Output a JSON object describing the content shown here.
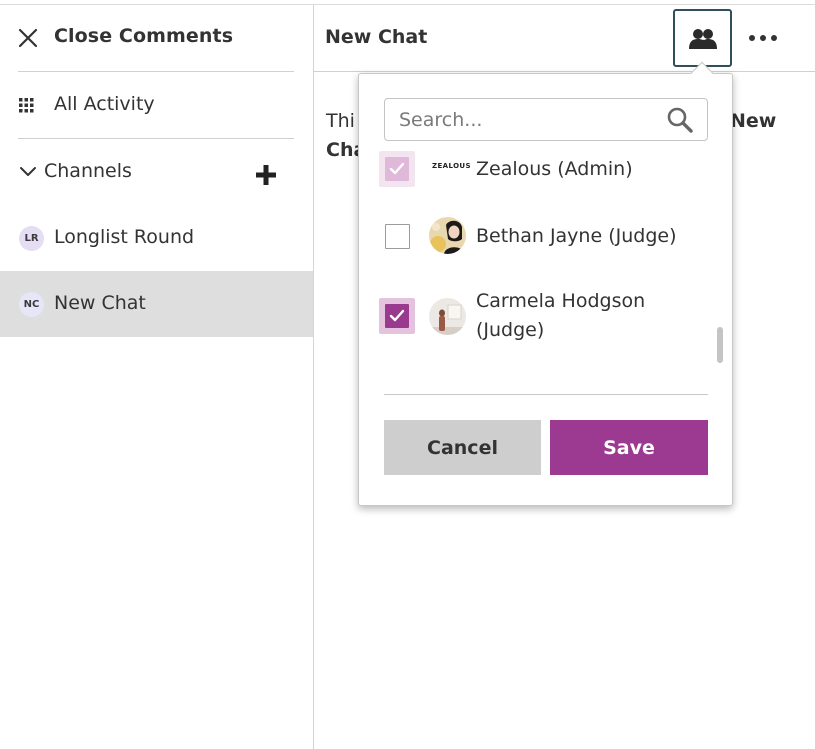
{
  "sidebar": {
    "close_label": "Close Comments",
    "activity_label": "All Activity",
    "channels_label": "Channels",
    "items": [
      {
        "initials": "LR",
        "label": "Longlist Round",
        "active": false
      },
      {
        "initials": "NC",
        "label": "New Chat",
        "active": true
      }
    ]
  },
  "header": {
    "title": "New Chat"
  },
  "main": {
    "text_prefix": "Thi",
    "text_bold_a": "New",
    "text_bold_b": "Cha"
  },
  "members_popover": {
    "search_placeholder": "Search...",
    "search_value": "",
    "members": [
      {
        "logo": "ZEALOUS",
        "name": "Zealous (Admin)",
        "checked": true,
        "disabled": true
      },
      {
        "name": "Bethan Jayne (Judge)",
        "checked": false
      },
      {
        "name_line1": "Carmela Hodgson",
        "name_line2": "(Judge)",
        "checked": true
      }
    ],
    "cancel_label": "Cancel",
    "save_label": "Save"
  },
  "colors": {
    "accent": "#9b3a90",
    "active_row": "#dedede",
    "members_button_border": "#2f4f5a"
  }
}
